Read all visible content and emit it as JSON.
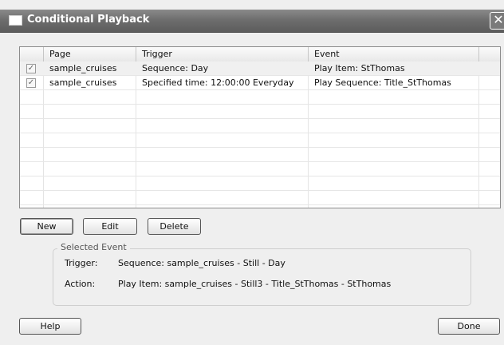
{
  "window": {
    "title": "Conditional Playback",
    "close": "✕"
  },
  "table": {
    "columns": [
      "Page",
      "Trigger",
      "Event"
    ],
    "rows": [
      {
        "checked": true,
        "page": "sample_cruises",
        "trigger": "Sequence: Day",
        "event": "Play Item: StThomas"
      },
      {
        "checked": true,
        "page": "sample_cruises",
        "trigger": "Specified time: 12:00:00 Everyday",
        "event": "Play Sequence: Title_StThomas"
      }
    ]
  },
  "buttons": {
    "new": "New",
    "edit": "Edit",
    "delete": "Delete",
    "help": "Help",
    "done": "Done"
  },
  "selected_event": {
    "legend": "Selected Event",
    "trigger_label": "Trigger:",
    "trigger_value": "Sequence: sample_cruises - Still - Day",
    "action_label": "Action:",
    "action_value": "Play Item: sample_cruises - Still3 - Title_StThomas - StThomas"
  },
  "icons": {
    "checkbox": "checkbox-checked-icon",
    "window": "window-icon",
    "close": "close-icon"
  },
  "colors": {
    "titlebar": "#6e6e6e",
    "window_bg": "#efefef",
    "selected_row": "#f0f0f0"
  }
}
